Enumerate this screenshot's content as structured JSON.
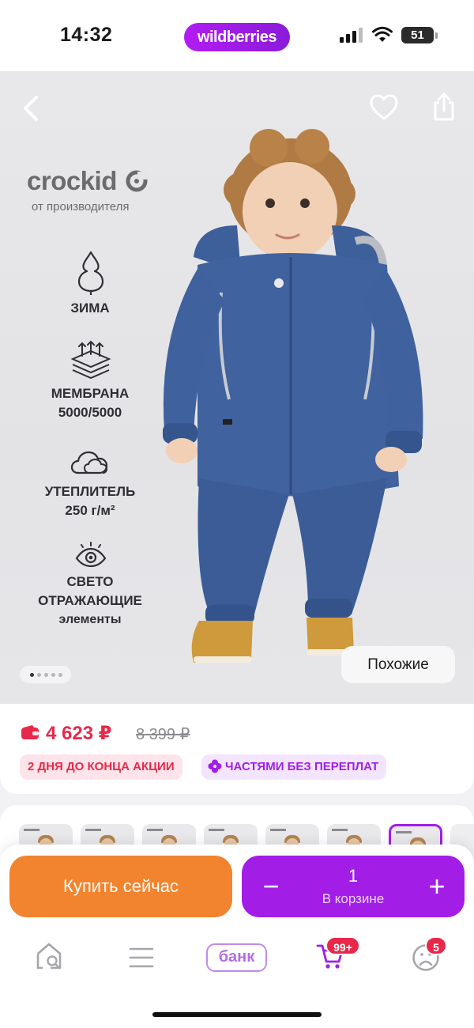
{
  "status_bar": {
    "time": "14:32",
    "app_pill": "wildberries",
    "battery": "51"
  },
  "hero": {
    "brand": "crockid",
    "brand_sub": "от производителя",
    "features": [
      {
        "icon": "snowflake-tree-icon",
        "lines": [
          "ЗИМА"
        ]
      },
      {
        "icon": "membrane-layers-icon",
        "lines": [
          "МЕМБРАНА",
          "5000/5000"
        ]
      },
      {
        "icon": "cloud-icon",
        "lines": [
          "УТЕПЛИТЕЛЬ",
          "250 г/м²"
        ]
      },
      {
        "icon": "eye-icon",
        "lines": [
          "СВЕТО",
          "ОТРАЖАЮЩИЕ"
        ],
        "small": "элементы"
      }
    ],
    "similar_label": "Похожие",
    "page_count": 5,
    "active_page": 1
  },
  "price": {
    "current": "4 623 ₽",
    "old": "8 399 ₽",
    "badge_sale": "2 ДНЯ ДО КОНЦА АКЦИИ",
    "badge_installments": "ЧАСТЯМИ БЕЗ ПЕРЕПЛАТ"
  },
  "actions": {
    "buy_label": "Купить сейчас",
    "cart_qty": "1",
    "cart_label": "В корзине",
    "minus": "−",
    "plus": "+"
  },
  "tab_bar": {
    "bank_label": "банк",
    "cart_count": "99+",
    "profile_count": "5"
  },
  "colors": {
    "brand_purple": "#a21ee6",
    "buy_orange": "#f2842f",
    "price_red": "#e8284a"
  }
}
